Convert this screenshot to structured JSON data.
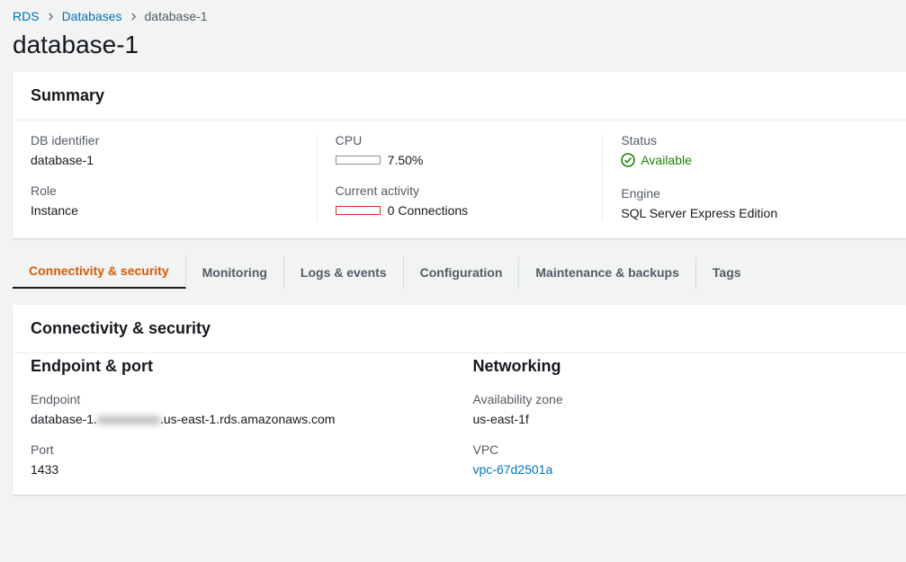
{
  "breadcrumbs": {
    "root": "RDS",
    "mid": "Databases",
    "current": "database-1"
  },
  "page_title": "database-1",
  "summary": {
    "header": "Summary",
    "db_identifier_label": "DB identifier",
    "db_identifier_value": "database-1",
    "role_label": "Role",
    "role_value": "Instance",
    "cpu_label": "CPU",
    "cpu_value_text": "7.50%",
    "cpu_percent": 7.5,
    "activity_label": "Current activity",
    "activity_value_text": "0 Connections",
    "activity_count": 0,
    "status_label": "Status",
    "status_value": "Available",
    "engine_label": "Engine",
    "engine_value": "SQL Server Express Edition"
  },
  "tabs": {
    "connectivity": "Connectivity & security",
    "monitoring": "Monitoring",
    "logs": "Logs & events",
    "configuration": "Configuration",
    "maintenance": "Maintenance & backups",
    "tags": "Tags"
  },
  "cs": {
    "header": "Connectivity & security",
    "endpoint_port_title": "Endpoint & port",
    "endpoint_label": "Endpoint",
    "endpoint_prefix": "database-1.",
    "endpoint_redacted": "xxxxxxxxxx",
    "endpoint_suffix": ".us-east-1.rds.amazonaws.com",
    "port_label": "Port",
    "port_value": "1433",
    "networking_title": "Networking",
    "az_label": "Availability zone",
    "az_value": "us-east-1f",
    "vpc_label": "VPC",
    "vpc_value": "vpc-67d2501a"
  }
}
